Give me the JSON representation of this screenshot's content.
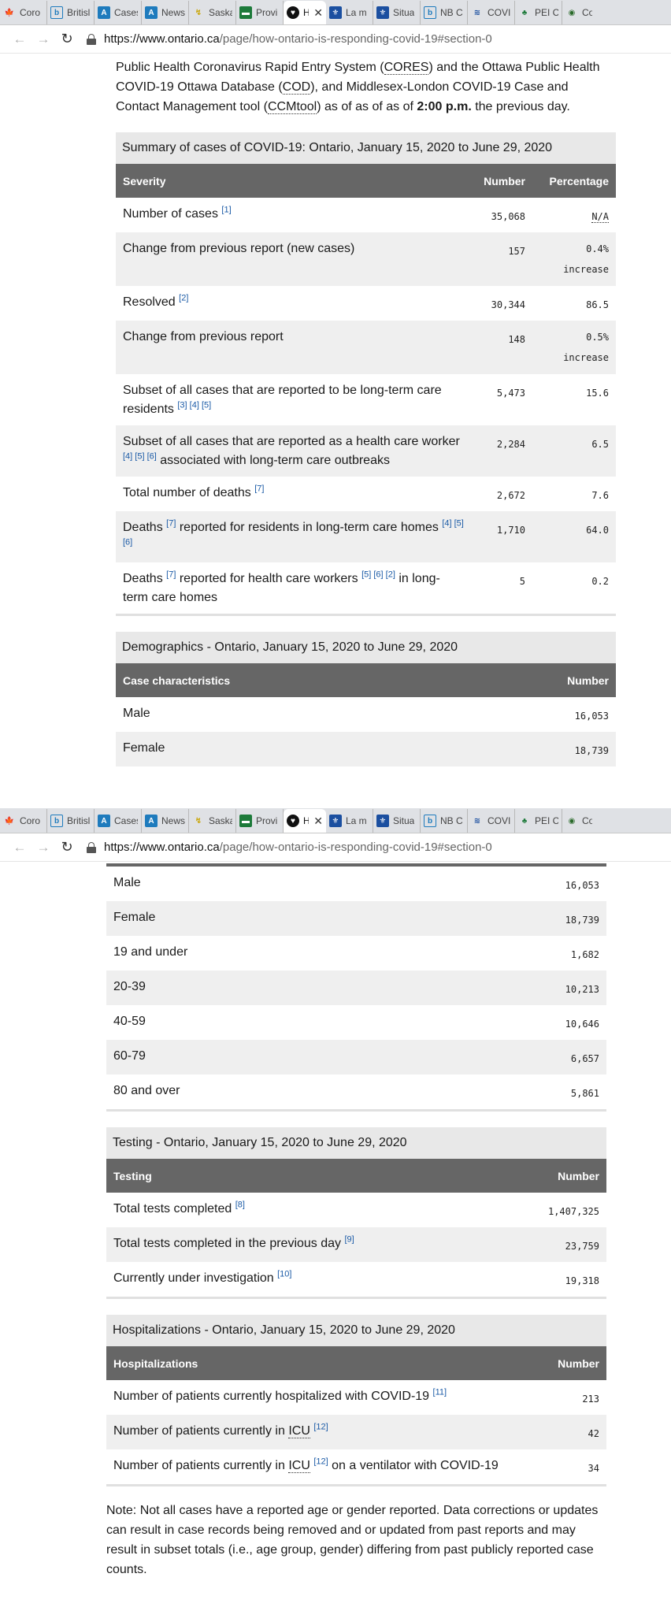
{
  "browser": {
    "tabs": [
      {
        "label": "Coro",
        "icon": "maple-leaf-icon"
      },
      {
        "label": "Britisl",
        "icon": "bc-icon"
      },
      {
        "label": "Cases",
        "icon": "alberta-icon"
      },
      {
        "label": "News",
        "icon": "alberta-icon"
      },
      {
        "label": "Saska",
        "icon": "saskatchewan-icon"
      },
      {
        "label": "Provi",
        "icon": "manitoba-icon"
      },
      {
        "label": "H",
        "icon": "ontario-icon"
      },
      {
        "label": "La m",
        "icon": "quebec-icon"
      },
      {
        "label": "Situa",
        "icon": "quebec-icon"
      },
      {
        "label": "NB C",
        "icon": "nb-icon"
      },
      {
        "label": "COVI",
        "icon": "ns-icon"
      },
      {
        "label": "PEI C",
        "icon": "pei-icon"
      },
      {
        "label": "Cov",
        "icon": "nl-icon"
      }
    ],
    "tabs2": [
      {
        "label": "Coro",
        "icon": "maple-leaf-icon"
      },
      {
        "label": "Britisl",
        "icon": "bc-icon"
      },
      {
        "label": "Cases",
        "icon": "alberta-icon"
      },
      {
        "label": "News",
        "icon": "alberta-icon"
      },
      {
        "label": "Saska",
        "icon": "saskatchewan-icon"
      },
      {
        "label": "Provi",
        "icon": "manitoba-icon"
      },
      {
        "label": "H",
        "icon": "ontario-icon"
      },
      {
        "label": "La m",
        "icon": "quebec-icon"
      },
      {
        "label": "Situa",
        "icon": "quebec-icon"
      },
      {
        "label": "NB C",
        "icon": "nb-icon"
      },
      {
        "label": "COVI",
        "icon": "ns-icon"
      },
      {
        "label": "PEI C",
        "icon": "pei-icon"
      },
      {
        "label": "Covic",
        "icon": "nl-icon"
      }
    ],
    "close_glyph": "✕",
    "url_host": "https://www.ontario.ca",
    "url_path": "/page/how-ontario-is-responding-covid-19#section-0"
  },
  "intro": {
    "line1_a": "Public Health Coronavirus Rapid Entry System (",
    "line1_abbr": "CORES",
    "line1_b": ") and the Ottawa Public Health",
    "line2_a": "COVID-19 Ottawa Database (",
    "line2_abbr": "COD",
    "line2_b": "), and Middlesex-London COVID-19 Case and",
    "line3_a": "Contact Management tool (",
    "line3_abbr": "CCMtool",
    "line3_b": ") as of as of as of ",
    "line3_bold": "2:00 p.m.",
    "line3_c": " the previous day."
  },
  "summary": {
    "caption": "Summary of cases of COVID-19: Ontario, January 15, 2020 to June 29, 2020",
    "headers": {
      "severity": "Severity",
      "number": "Number",
      "percentage": "Percentage"
    },
    "rows": [
      {
        "label": "Number of cases",
        "fn": "[1]",
        "number": "35,068",
        "pct": "N/A",
        "pct_sub": ""
      },
      {
        "label": "Change from previous report (new cases)",
        "fn": "",
        "number": "157",
        "pct": "0.4%",
        "pct_sub": "increase"
      },
      {
        "label": "Resolved",
        "fn": "[2]",
        "number": "30,344",
        "pct": "86.5",
        "pct_sub": ""
      },
      {
        "label": "Change from previous report",
        "fn": "",
        "number": "148",
        "pct": "0.5%",
        "pct_sub": "increase"
      },
      {
        "label": "Subset of all cases that are reported to be long-term care residents",
        "fn": "[3] [4] [5]",
        "number": "5,473",
        "pct": "15.6",
        "pct_sub": ""
      },
      {
        "label_a": "Subset of all cases that are reported as a health care worker",
        "fn": "[4] [5] [6]",
        "label_b": "associated with long-term care outbreaks",
        "number": "2,284",
        "pct": "6.5"
      },
      {
        "label": "Total number of deaths",
        "fn": "[7]",
        "number": "2,672",
        "pct": "7.6",
        "pct_sub": ""
      },
      {
        "label_a": "Deaths",
        "fn_a": "[7]",
        "label_b": "reported for residents in long-term care homes",
        "fn_b": "[4] [5] [6]",
        "number": "1,710",
        "pct": "64.0"
      },
      {
        "label_a": "Deaths",
        "fn_a": "[7]",
        "label_b": "reported for health care workers",
        "fn_b": "[5] [6] [2]",
        "label_c": "in long-term care homes",
        "number": "5",
        "pct": "0.2"
      }
    ]
  },
  "demographics": {
    "caption": "Demographics - Ontario, January 15, 2020 to June 29, 2020",
    "headers": {
      "char": "Case characteristics",
      "number": "Number"
    },
    "rows": [
      {
        "label": "Male",
        "number": "16,053"
      },
      {
        "label": "Female",
        "number": "18,739"
      },
      {
        "label": "19 and under",
        "number": "1,682"
      },
      {
        "label": "20-39",
        "number": "10,213"
      },
      {
        "label": "40-59",
        "number": "10,646"
      },
      {
        "label": "60-79",
        "number": "6,657"
      },
      {
        "label": "80 and over",
        "number": "5,861"
      }
    ]
  },
  "testing": {
    "caption": "Testing - Ontario, January 15, 2020 to June 29, 2020",
    "headers": {
      "testing": "Testing",
      "number": "Number"
    },
    "rows": [
      {
        "label": "Total tests completed",
        "fn": "[8]",
        "number": "1,407,325"
      },
      {
        "label": "Total tests completed in the previous day",
        "fn": "[9]",
        "number": "23,759"
      },
      {
        "label": "Currently under investigation",
        "fn": "[10]",
        "number": "19,318"
      }
    ]
  },
  "hospitalizations": {
    "caption": "Hospitalizations - Ontario, January 15, 2020 to June 29, 2020",
    "headers": {
      "hosp": "Hospitalizations",
      "number": "Number"
    },
    "rows": [
      {
        "label_a": "Number of patients currently hospitalized with COVID-19",
        "fn": "[11]",
        "number": "213"
      },
      {
        "label_a": "Number of patients currently in ",
        "abbr": "ICU",
        "fn": "[12]",
        "number": "42"
      },
      {
        "label_a": "Number of patients currently in ",
        "abbr": "ICU",
        "fn": "[12]",
        "label_b": "on a ventilator with COVID-19",
        "number": "34"
      }
    ]
  },
  "note": "Note: Not all cases have a reported age or gender reported. Data corrections or updates can result in case records being removed and or updated from past reports and may result in subset totals (i.e., age group, gender) differing from past publicly reported case counts.",
  "colors": {
    "table_header": "#666666",
    "caption_bg": "#e8e8e8",
    "stripe": "#efefef",
    "link": "#1a5aa6"
  }
}
